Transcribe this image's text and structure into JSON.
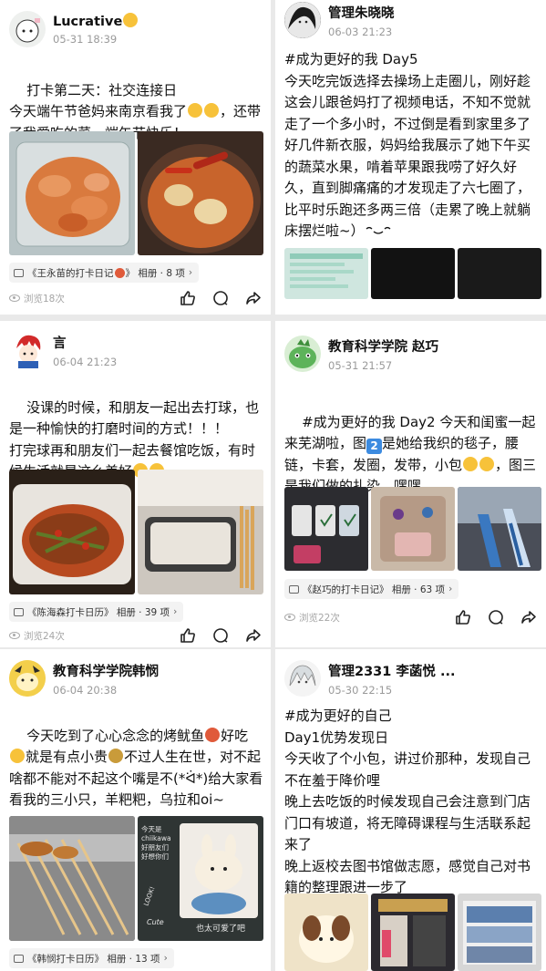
{
  "posts": [
    {
      "name": "Lucrative",
      "time": "05-31 18:39",
      "lines": [
        "打卡第二天：社交连接日",
        "今天端午节爸妈来南京看我了",
        "，还带了我爱吃的菜，端午节快乐！"
      ],
      "album": "《王永苗的打卡日记",
      "album_count": "相册 · 8 项",
      "views": "浏览18次"
    },
    {
      "name": "管理朱晓晓",
      "time": "06-03 21:23",
      "text": "#成为更好的我 Day5\n今天吃完饭选择去操场上走圈儿，刚好趁这会儿跟爸妈打了视频电话，不知不觉就走了一个多小时，不过倒是看到家里多了好几件新衣服，妈妈给我展示了她下午买的蔬菜水果，啃着苹果跟我唠了好久好久，直到脚痛痛的才发现走了六七圈了，比平时乐跑还多两三倍（走累了晚上就躺床摆烂啦~）"
    },
    {
      "name": "言",
      "time": "06-04 21:23",
      "lines": [
        "没课的时候，和朋友一起出去打球，也是一种愉快的打磨时间的方式！！！",
        "打完球再和朋友们一起去餐馆吃饭，有时候生活就是这么美好"
      ],
      "album": "《陈海森打卡日历》",
      "album_count": "相册 · 39 项",
      "views": "浏览24次"
    },
    {
      "name": "教育科学学院 赵巧",
      "time": "05-31 21:57",
      "text_a": "#成为更好的我 Day2 今天和闺蜜一起来芜湖啦，图",
      "num": "2",
      "text_b": "是她给我织的毯子，腰链，卡套，发圈，发带，小包",
      "text_c": "，图三是我们做的扎染，嘿嘿",
      "album": "《赵巧的打卡日记》",
      "album_count": "相册 · 63 项",
      "views": "浏览22次"
    },
    {
      "name": "教育科学学院韩悯",
      "time": "06-04 20:38",
      "text_a": "今天吃到了心心念念的烤鱿鱼",
      "text_b": "好吃",
      "text_c": "就是有点小贵",
      "text_d": "不过人生在世，对不起啥都不能对不起这个嘴是不(*ᐛ*)给大家看看我的三小只，羊粑粑，乌拉和oi~",
      "img_note": "今天是\nchiikawa\n好朋友们\n好想你们",
      "img_cute": "Cute",
      "img_look": "LOOK!",
      "img_caption": "也太可爱了吧",
      "album": "《韩悯打卡日历》",
      "album_count": "相册 · 13 项"
    },
    {
      "name": "管理2331 李菡悦 ...",
      "time": "05-30 22:15",
      "text": "#成为更好的自己\nDay1优势发现日\n今天收了个小包，讲过价那种，发现自己不在羞于降价哩\n晚上去吃饭的时候发现自己会注意到门店门口有坡道，将无障碍课程与生活联系起来了\n晚上返校去图书馆做志愿，感觉自己对书籍的整理跟进一步了"
    }
  ],
  "colors": {
    "bg": "#e9e9e9",
    "card": "#ffffff",
    "muted": "#9a9a9a",
    "accent": "#3c8be0"
  },
  "icons": [
    "like-icon",
    "comment-icon",
    "share-icon",
    "eye-icon",
    "album-icon"
  ]
}
